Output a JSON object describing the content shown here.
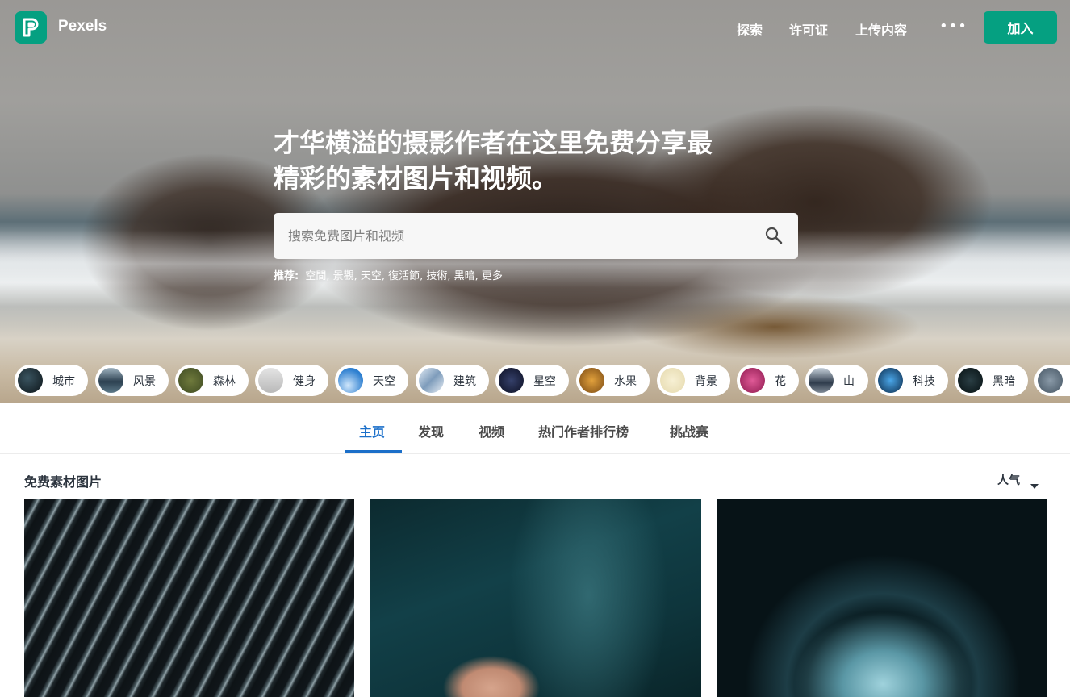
{
  "colors": {
    "brand": "#05a081",
    "accent": "#1b6fc9",
    "text": "#2c343e"
  },
  "nav": {
    "logo_text": "Pexels",
    "links": [
      "探索",
      "许可证",
      "上传内容"
    ],
    "more": "•••",
    "join": "加入"
  },
  "hero": {
    "headline_line1": "才华横溢的摄影作者在这里免费分享最",
    "headline_line2": "精彩的素材图片和视频。",
    "search_placeholder": "搜索免费图片和视频",
    "suggest_label": "推荐:",
    "suggestions": "空間, 景觀, 天空, 復活節, 技術, 黑暗, 更多"
  },
  "categories": [
    "城市",
    "风景",
    "森林",
    "健身",
    "天空",
    "建筑",
    "星空",
    "水果",
    "背景",
    "花",
    "山",
    "科技",
    "黑暗"
  ],
  "tabs": [
    "主页",
    "发现",
    "视频",
    "热门作者排行榜",
    "挑战赛"
  ],
  "section": {
    "title": "免费素材图片",
    "sort": "人气"
  },
  "icons": [
    "pexels-logo-icon",
    "more-icon",
    "search-icon",
    "caret-down-icon"
  ]
}
